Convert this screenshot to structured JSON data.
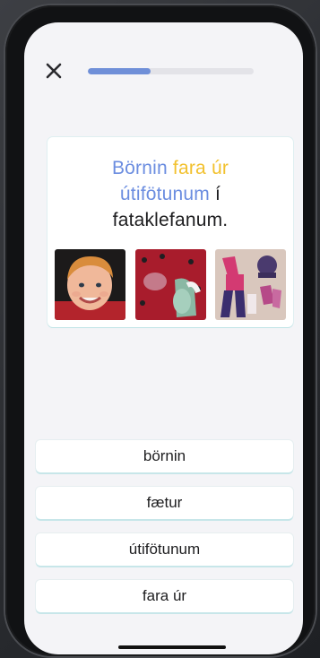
{
  "lesson": {
    "progress": 0.38
  },
  "prompt": {
    "word1": "Börnin",
    "word2": "fara úr",
    "word3": "útifötunum",
    "word4": "í",
    "word5": "fataklefanum."
  },
  "images": [
    {
      "icon": "child-face-photo"
    },
    {
      "icon": "mittens-photo"
    },
    {
      "icon": "winter-clothes-photo"
    }
  ],
  "choices": [
    {
      "label": "börnin"
    },
    {
      "label": "fætur"
    },
    {
      "label": "útifötunum"
    },
    {
      "label": "fara úr"
    }
  ],
  "colors": {
    "accent_blue": "#6b8de0",
    "accent_gold": "#f2c12e",
    "progress_fill": "#6f8fd8"
  }
}
